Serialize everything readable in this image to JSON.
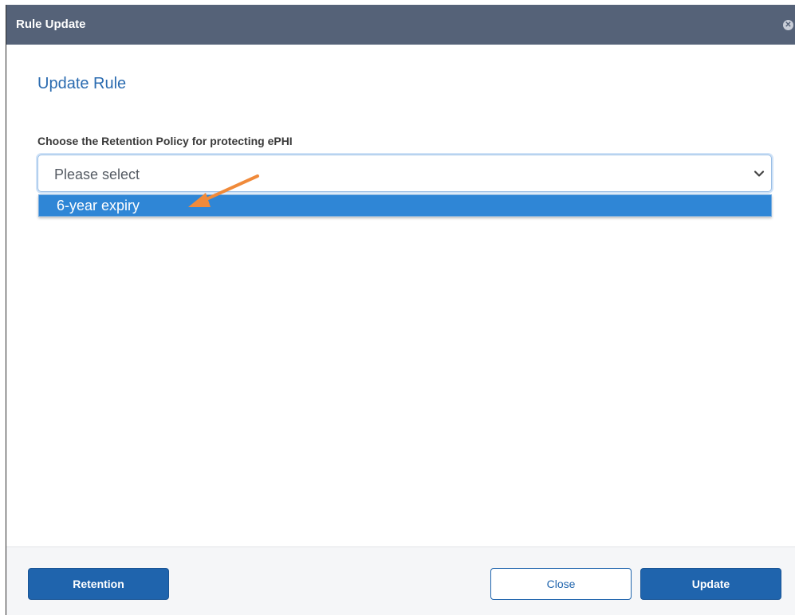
{
  "dialog": {
    "title": "Rule Update",
    "close_icon": "close-circle-icon",
    "heading": "Update Rule"
  },
  "form": {
    "label": "Choose the Retention Policy for protecting ePHI",
    "select": {
      "value": "Please select",
      "options": [
        "6-year expiry"
      ],
      "highlighted_option": "6-year expiry"
    }
  },
  "annotation": {
    "arrow_icon": "arrow-pointer-icon",
    "color": "#f08a3a"
  },
  "footer": {
    "retention_label": "Retention",
    "close_label": "Close",
    "update_label": "Update"
  },
  "colors": {
    "titlebar": "#556278",
    "accent": "#1f64ad",
    "highlight": "#2f86d6"
  }
}
